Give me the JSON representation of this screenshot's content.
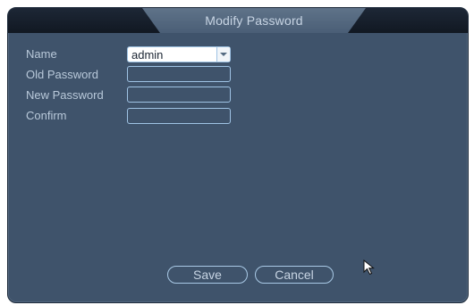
{
  "dialog": {
    "title": "Modify Password",
    "fields": {
      "name_label": "Name",
      "name_value": "admin",
      "old_password_label": "Old Password",
      "new_password_label": "New Password",
      "confirm_label": "Confirm"
    },
    "buttons": {
      "save_label": "Save",
      "cancel_label": "Cancel"
    }
  },
  "icons": {
    "dropdown": "chevron-down-icon",
    "cursor": "mouse-pointer-icon"
  },
  "colors": {
    "panel_bg": "#3f536b",
    "field_border": "#9fc3e4",
    "label_text": "#b9c9da"
  }
}
